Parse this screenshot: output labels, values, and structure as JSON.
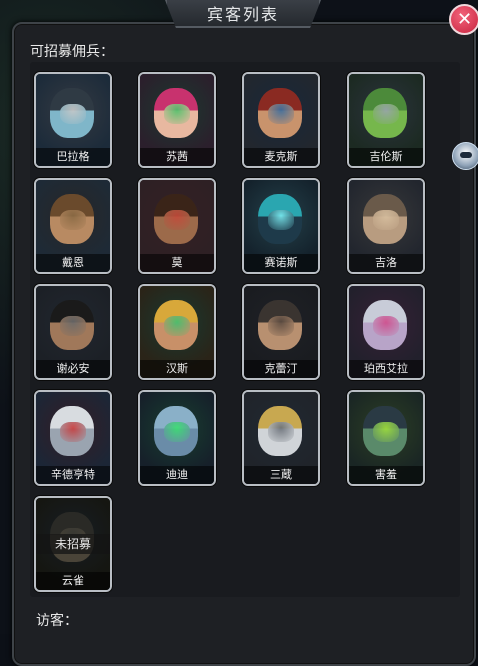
{
  "window": {
    "title": "宾客列表"
  },
  "sections": {
    "recruitable_label": "可招募佣兵：",
    "visitors_label": "访客："
  },
  "mercenaries": [
    {
      "name": "巴拉格",
      "hair": "#2f3a44",
      "skin": "#7fb6c9",
      "accent": "#c8c8c8",
      "bg": "#1c2b3a"
    },
    {
      "name": "苏茜",
      "hair": "#c8326e",
      "skin": "#e8b8a0",
      "accent": "#4cc36a",
      "bg": "#2b1f2c"
    },
    {
      "name": "麦克斯",
      "hair": "#8a2a22",
      "skin": "#c9936c",
      "accent": "#3a6ea0",
      "bg": "#22272e"
    },
    {
      "name": "吉伦斯",
      "hair": "#4c8a3a",
      "skin": "#76b74c",
      "accent": "#9aa4ae",
      "bg": "#1c2a22"
    },
    {
      "name": "戴恩",
      "hair": "#6a4a2c",
      "skin": "#b88a62",
      "accent": "#8a6a44",
      "bg": "#1e2a36"
    },
    {
      "name": "莫",
      "hair": "#3a2418",
      "skin": "#9c6a4a",
      "accent": "#c44a3a",
      "bg": "#2e2024"
    },
    {
      "name": "赛诺斯",
      "hair": "#2aa6b0",
      "skin": "#1e3a4a",
      "accent": "#7aeaf0",
      "bg": "#14222c"
    },
    {
      "name": "吉洛",
      "hair": "#6a5a4a",
      "skin": "#b89c80",
      "accent": "#d8c0a0",
      "bg": "#22262e"
    },
    {
      "name": "谢必安",
      "hair": "#1a1a1a",
      "skin": "#a0785a",
      "accent": "#6a6a6a",
      "bg": "#1c2026"
    },
    {
      "name": "汉斯",
      "hair": "#d8a83a",
      "skin": "#c89068",
      "accent": "#40c070",
      "bg": "#2a2418"
    },
    {
      "name": "克蕾汀",
      "hair": "#3a3430",
      "skin": "#b89070",
      "accent": "#5a4a40",
      "bg": "#1a1c20"
    },
    {
      "name": "珀西艾拉",
      "hair": "#c8ccd8",
      "skin": "#b8a4c8",
      "accent": "#d04a8a",
      "bg": "#22202c"
    },
    {
      "name": "辛德亨特",
      "hair": "#d8dce0",
      "skin": "#9aa4b0",
      "accent": "#c83a3a",
      "bg": "#1c2636"
    },
    {
      "name": "迪迪",
      "hair": "#8ab0c8",
      "skin": "#6a8ca8",
      "accent": "#3ae070",
      "bg": "#16202a"
    },
    {
      "name": "三蔵",
      "hair": "#c8a850",
      "skin": "#d0d4d8",
      "accent": "#6a7078",
      "bg": "#20242a"
    },
    {
      "name": "害羞",
      "hair": "#2a3a44",
      "skin": "#5a8a6a",
      "accent": "#a0e03a",
      "bg": "#1a2624"
    },
    {
      "name": "云雀",
      "hair": "#2a2a26",
      "skin": "#4a4438",
      "accent": "#3a3a34",
      "bg": "#151611",
      "status": "未招募"
    }
  ],
  "colors": {
    "panel_bg": "#1e2024",
    "card_border": "#b9bec4",
    "close_button": "#d8304a"
  },
  "icons": {
    "close": "close-icon",
    "side": "ufo-icon"
  }
}
